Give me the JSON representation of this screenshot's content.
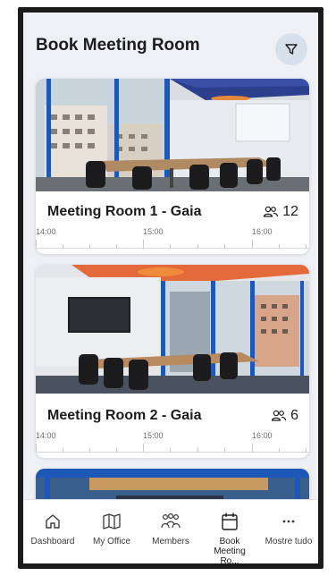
{
  "header": {
    "title": "Book Meeting Room",
    "filter_icon": "filter-icon"
  },
  "rooms": [
    {
      "name": "Meeting Room 1 - Gaia",
      "capacity": "12",
      "times": [
        "14:00",
        "15:00",
        "16:00"
      ]
    },
    {
      "name": "Meeting Room 2 - Gaia",
      "capacity": "6",
      "times": [
        "14:00",
        "15:00",
        "16:00"
      ]
    }
  ],
  "tabs": [
    {
      "label": "Dashboard",
      "icon": "home-icon"
    },
    {
      "label": "My Office",
      "icon": "map-icon"
    },
    {
      "label": "Members",
      "icon": "members-icon"
    },
    {
      "label": "Book Meeting Ro...",
      "icon": "calendar-icon",
      "active": true
    },
    {
      "label": "Mostre tudo",
      "icon": "more-icon"
    }
  ],
  "colors": {
    "background": "#eef0f4",
    "filter_button": "#d6e1ec",
    "text": "#1c1c1e"
  }
}
